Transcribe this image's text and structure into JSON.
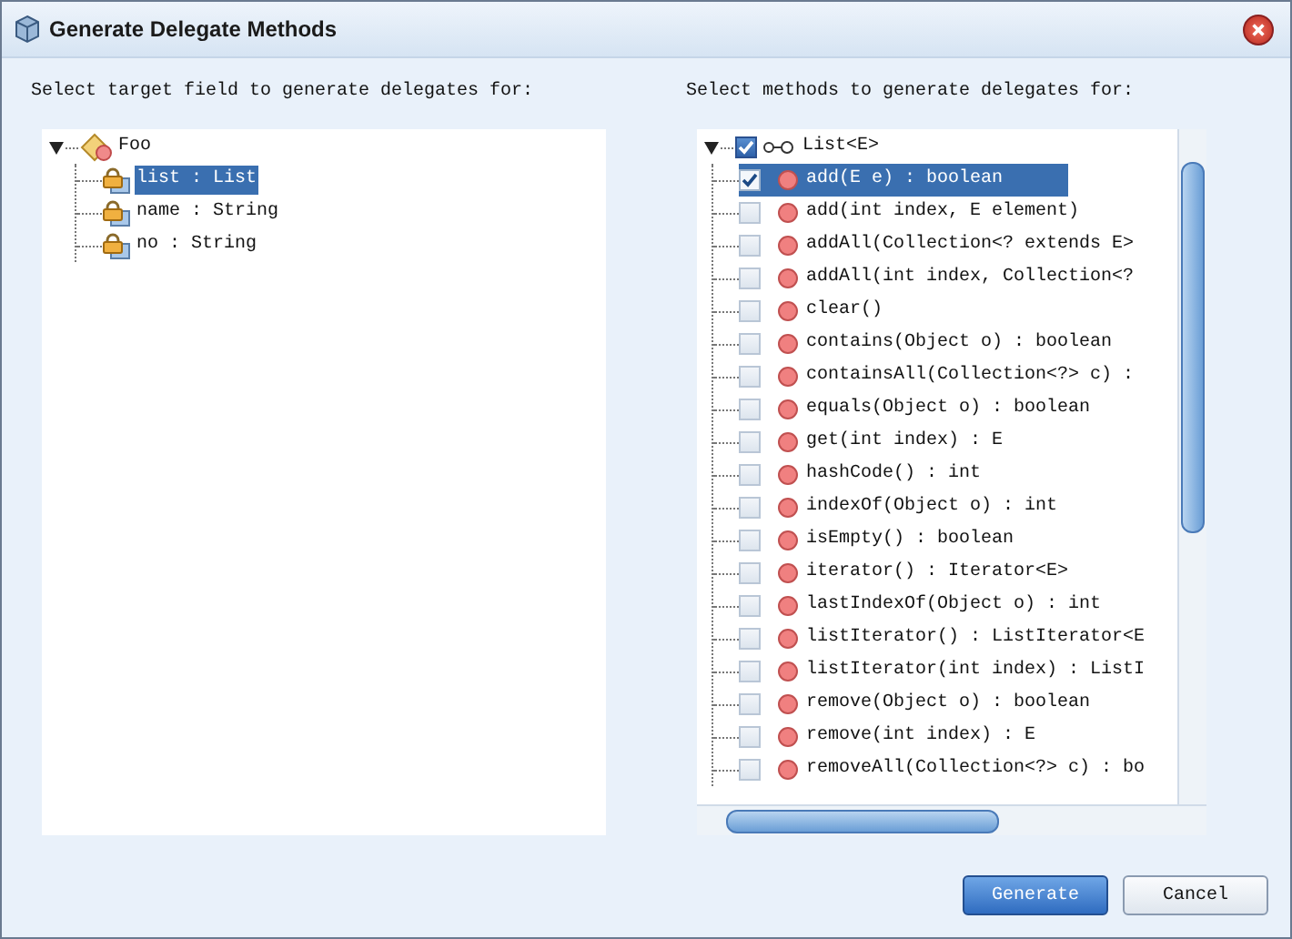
{
  "window": {
    "title": "Generate Delegate Methods"
  },
  "fields_panel": {
    "label": "Select target field to generate delegates for:",
    "root": {
      "label": "Foo",
      "expanded": true,
      "children": [
        {
          "label": "list : List",
          "selected": true
        },
        {
          "label": "name : String",
          "selected": false
        },
        {
          "label": "no : String",
          "selected": false
        }
      ]
    }
  },
  "methods_panel": {
    "label": "Select methods to generate delegates for:",
    "root": {
      "label": "List<E>",
      "checked": true,
      "expanded": true,
      "children": [
        {
          "label": "add(E e) : boolean",
          "checked": true,
          "selected": true
        },
        {
          "label": "add(int index, E element)",
          "checked": false,
          "selected": false
        },
        {
          "label": "addAll(Collection<? extends E>",
          "checked": false,
          "selected": false
        },
        {
          "label": "addAll(int index, Collection<?",
          "checked": false,
          "selected": false
        },
        {
          "label": "clear()",
          "checked": false,
          "selected": false
        },
        {
          "label": "contains(Object o) : boolean",
          "checked": false,
          "selected": false
        },
        {
          "label": "containsAll(Collection<?> c) :",
          "checked": false,
          "selected": false
        },
        {
          "label": "equals(Object o) : boolean",
          "checked": false,
          "selected": false
        },
        {
          "label": "get(int index) : E",
          "checked": false,
          "selected": false
        },
        {
          "label": "hashCode() : int",
          "checked": false,
          "selected": false
        },
        {
          "label": "indexOf(Object o) : int",
          "checked": false,
          "selected": false
        },
        {
          "label": "isEmpty() : boolean",
          "checked": false,
          "selected": false
        },
        {
          "label": "iterator() : Iterator<E>",
          "checked": false,
          "selected": false
        },
        {
          "label": "lastIndexOf(Object o) : int",
          "checked": false,
          "selected": false
        },
        {
          "label": "listIterator() : ListIterator<E",
          "checked": false,
          "selected": false
        },
        {
          "label": "listIterator(int index) : ListI",
          "checked": false,
          "selected": false
        },
        {
          "label": "remove(Object o) : boolean",
          "checked": false,
          "selected": false
        },
        {
          "label": "remove(int index) : E",
          "checked": false,
          "selected": false
        },
        {
          "label": "removeAll(Collection<?> c) : bo",
          "checked": false,
          "selected": false
        }
      ]
    }
  },
  "buttons": [
    {
      "label": "Generate",
      "kind": "primary"
    },
    {
      "label": "Cancel",
      "kind": "secondary"
    }
  ]
}
